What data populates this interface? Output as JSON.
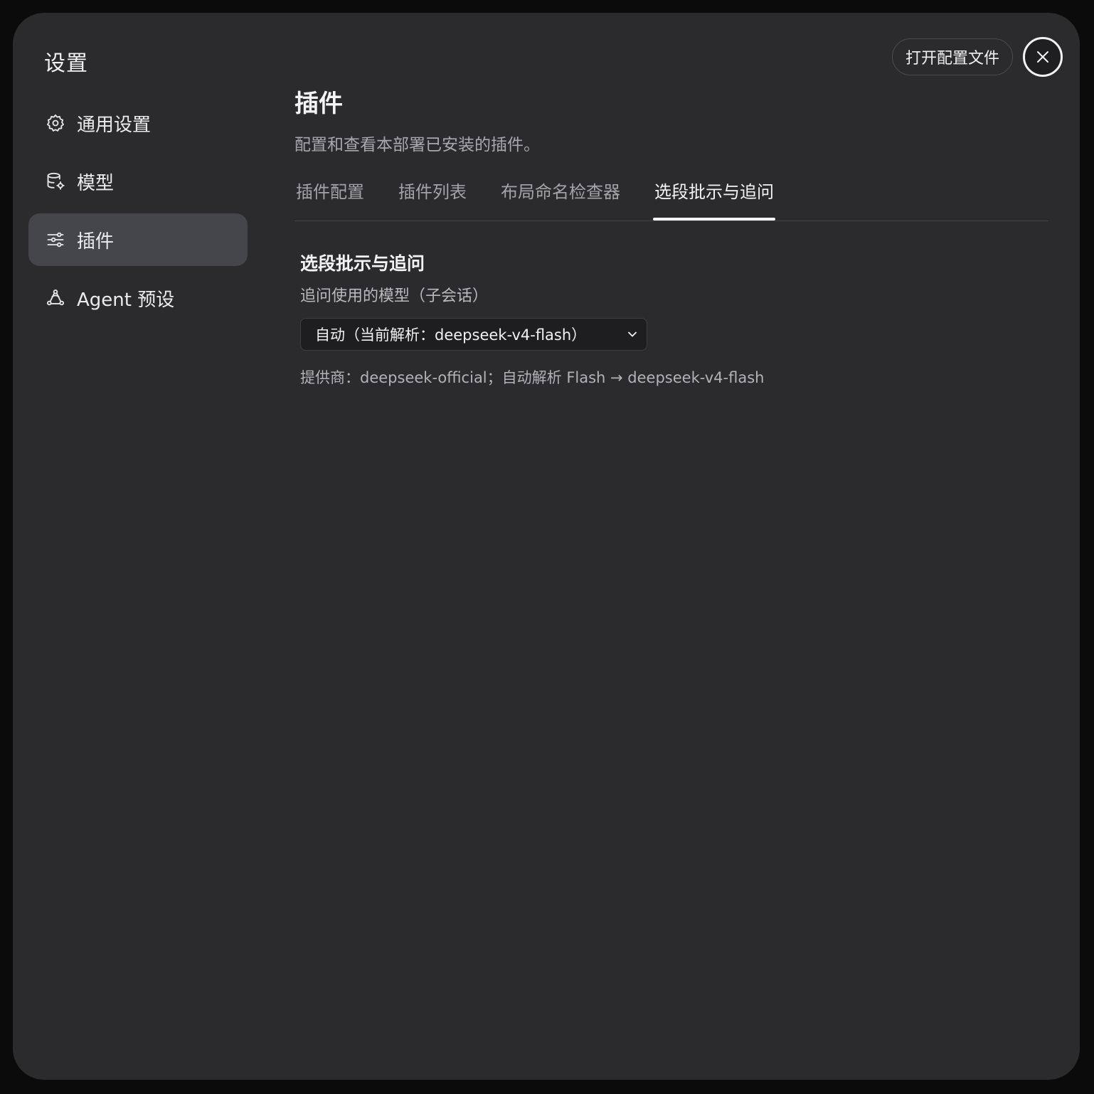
{
  "settings_title": "设置",
  "sidebar": {
    "items": [
      {
        "label": "通用设置",
        "icon": "gear-icon",
        "active": false
      },
      {
        "label": "模型",
        "icon": "database-icon",
        "active": false
      },
      {
        "label": "插件",
        "icon": "sliders-icon",
        "active": true
      },
      {
        "label": "Agent 预设",
        "icon": "agent-icon",
        "active": false
      }
    ]
  },
  "toolbar": {
    "open_config_label": "打开配置文件",
    "close_icon": "close-icon"
  },
  "page": {
    "title": "插件",
    "description": "配置和查看本部署已安装的插件。"
  },
  "tabs": [
    {
      "label": "插件配置",
      "active": false
    },
    {
      "label": "插件列表",
      "active": false
    },
    {
      "label": "布局命名检查器",
      "active": false
    },
    {
      "label": "选段批示与追问",
      "active": true
    }
  ],
  "section": {
    "title": "选段批示与追问",
    "model_label": "追问使用的模型（子会话）",
    "model_select_value": "自动（当前解析：deepseek-v4-flash）",
    "provider_hint": "提供商：deepseek-official；自动解析 Flash → deepseek-v4-flash"
  },
  "colors": {
    "modal_bg": "#2b2b2e",
    "active_item_bg": "#45464b",
    "backdrop": "#0b0b0c"
  }
}
